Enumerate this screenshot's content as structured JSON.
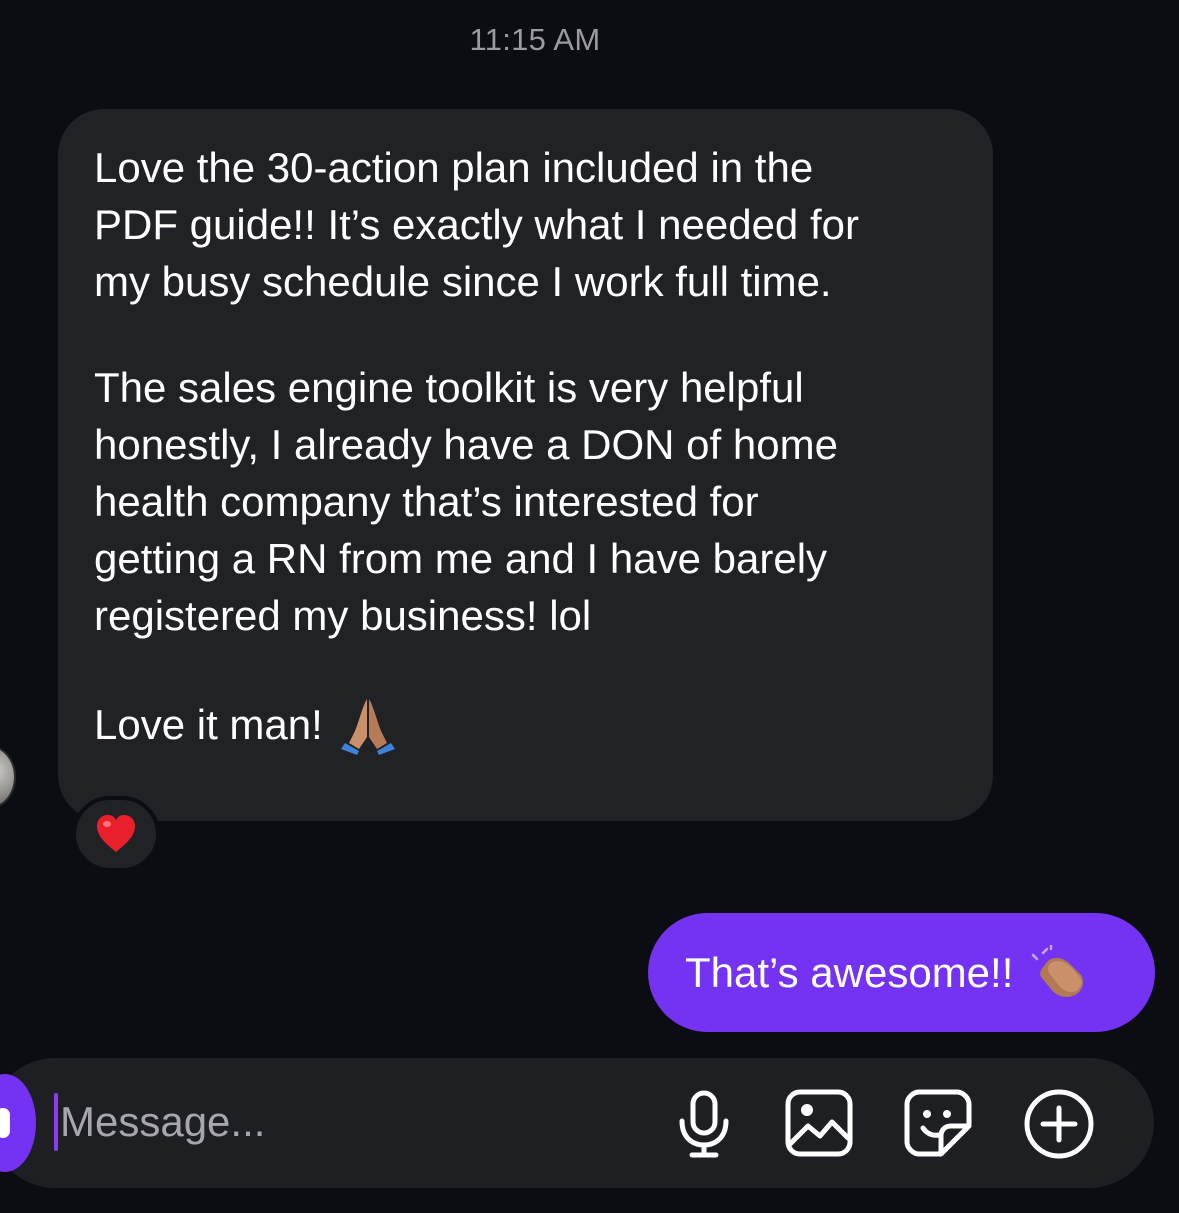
{
  "timestamp": "11:15 AM",
  "incoming_message": {
    "paragraphs": [
      "Love the 30-action plan included in the\nPDF guide!!  It’s exactly what I needed for\nmy busy schedule since I work full time.",
      "The sales engine toolkit is very helpful\nhonestly, I already have a DON of home\nhealth company that’s interested for\ngetting a RN from me and I have barely\nregistered my business! lol",
      "Love it man!"
    ],
    "emoji": "praying-hands",
    "reaction": "heart"
  },
  "outgoing_message": {
    "text": "That’s awesome!!",
    "emoji": "clapping-hands"
  },
  "composer": {
    "placeholder": "Message...",
    "icons": [
      "microphone-icon",
      "gallery-icon",
      "sticker-icon",
      "add-icon"
    ]
  },
  "colors": {
    "background": "#0c0d12",
    "incoming_bubble": "#202226",
    "outgoing_bubble": "#7433f2",
    "composer": "#1d1f23"
  }
}
